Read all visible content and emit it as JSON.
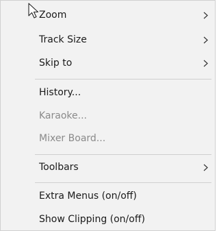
{
  "menu": {
    "items": [
      {
        "label": "Zoom",
        "has_submenu": true,
        "enabled": true
      },
      {
        "label": "Track Size",
        "has_submenu": true,
        "enabled": true
      },
      {
        "label": "Skip to",
        "has_submenu": true,
        "enabled": true
      },
      {
        "label": "History...",
        "has_submenu": false,
        "enabled": true
      },
      {
        "label": "Karaoke...",
        "has_submenu": false,
        "enabled": false
      },
      {
        "label": "Mixer Board...",
        "has_submenu": false,
        "enabled": false
      },
      {
        "label": "Toolbars",
        "has_submenu": true,
        "enabled": true
      },
      {
        "label": "Extra Menus (on/off)",
        "has_submenu": false,
        "enabled": true
      },
      {
        "label": "Show Clipping (on/off)",
        "has_submenu": false,
        "enabled": true
      }
    ]
  },
  "colors": {
    "menu_background": "#f2f2f2",
    "text": "#1a1a1a",
    "disabled_text": "#8a8a8a",
    "separator": "#cfcfcf"
  },
  "icons": {
    "submenu_arrow": "chevron-right-icon",
    "cursor": "mouse-pointer-icon"
  }
}
